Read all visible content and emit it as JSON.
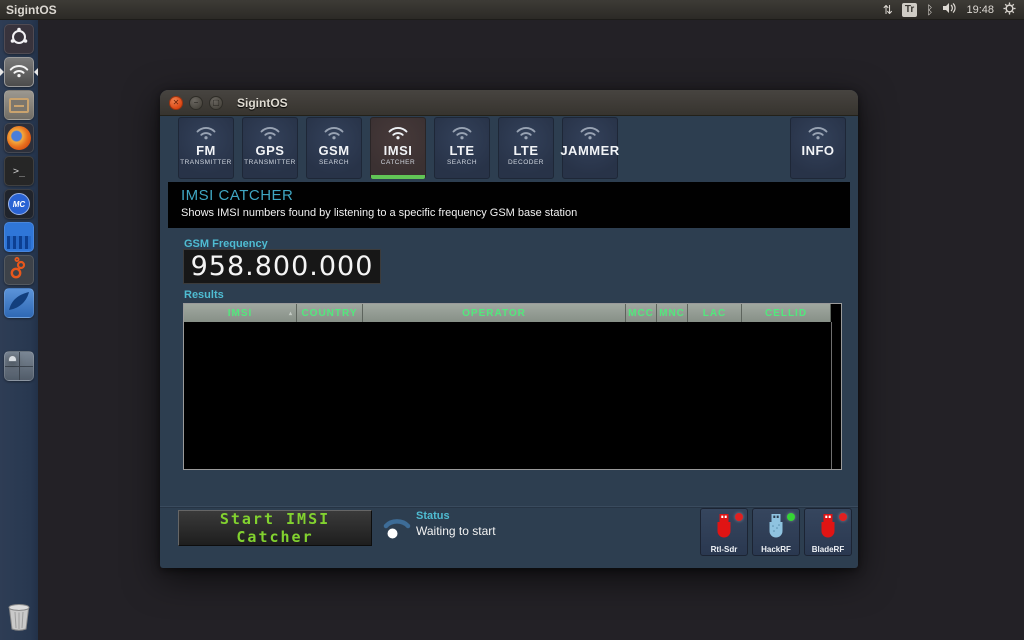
{
  "topbar": {
    "app_name": "SigintOS",
    "network_arrows_glyph": "⇅",
    "keyboard_indicator": "Tr",
    "bluetooth_glyph": "ᛒ",
    "clock": "19:48"
  },
  "launcher": {
    "items": [
      {
        "name": "dash-home"
      },
      {
        "name": "sigintos-wifi",
        "active": true
      },
      {
        "name": "file-manager"
      },
      {
        "name": "firefox"
      },
      {
        "name": "terminal"
      },
      {
        "name": "midnight-commander",
        "label": "MC"
      },
      {
        "name": "spectrum-analyzer"
      },
      {
        "name": "gnuradio"
      },
      {
        "name": "wireshark"
      },
      {
        "name": "workspace-switcher"
      },
      {
        "name": "trash"
      }
    ],
    "terminal_glyph": ">_",
    "mc_label": "MC"
  },
  "window": {
    "title": "SigintOS",
    "toolbar": {
      "buttons": [
        {
          "label": "FM",
          "sublabel": "TRANSMITTER",
          "active": false
        },
        {
          "label": "GPS",
          "sublabel": "TRANSMITTER",
          "active": false
        },
        {
          "label": "GSM",
          "sublabel": "SEARCH",
          "active": false
        },
        {
          "label": "IMSI",
          "sublabel": "CATCHER",
          "active": true
        },
        {
          "label": "LTE",
          "sublabel": "SEARCH",
          "active": false
        },
        {
          "label": "LTE",
          "sublabel": "DECODER",
          "active": false
        },
        {
          "label": "JAMMER",
          "sublabel": "",
          "active": false
        }
      ],
      "info_button": {
        "label": "INFO"
      }
    },
    "banner": {
      "title": "IMSI CATCHER",
      "subtitle": "Shows IMSI numbers found by listening to a specific frequency GSM base station"
    },
    "frequency": {
      "label": "GSM Frequency",
      "value": "958.800.000"
    },
    "results": {
      "label": "Results",
      "columns": [
        "IMSI",
        "COUNTRY",
        "OPERATOR",
        "MCC",
        "MNC",
        "LAC",
        "CELLID"
      ],
      "sort_indicator": "▴",
      "rows": []
    },
    "controls": {
      "start_button": "Start IMSI Catcher",
      "status_label": "Status",
      "status_value": "Waiting to start"
    },
    "devices": [
      {
        "label": "Rtl-Sdr",
        "led": "red",
        "led_color": "#e02020",
        "plug_color": "#e01414"
      },
      {
        "label": "HackRF",
        "led": "green",
        "led_color": "#35d435",
        "plug_color": "#8fc3e0"
      },
      {
        "label": "BladeRF",
        "led": "red",
        "led_color": "#e02020",
        "plug_color": "#e01414"
      }
    ]
  },
  "colors": {
    "accent_teal": "#4fbcd2",
    "table_header_green": "#52e87c",
    "start_button_green": "#82d22f",
    "active_tab_underline": "#61c556",
    "close_button_orange": "#dd4814"
  }
}
